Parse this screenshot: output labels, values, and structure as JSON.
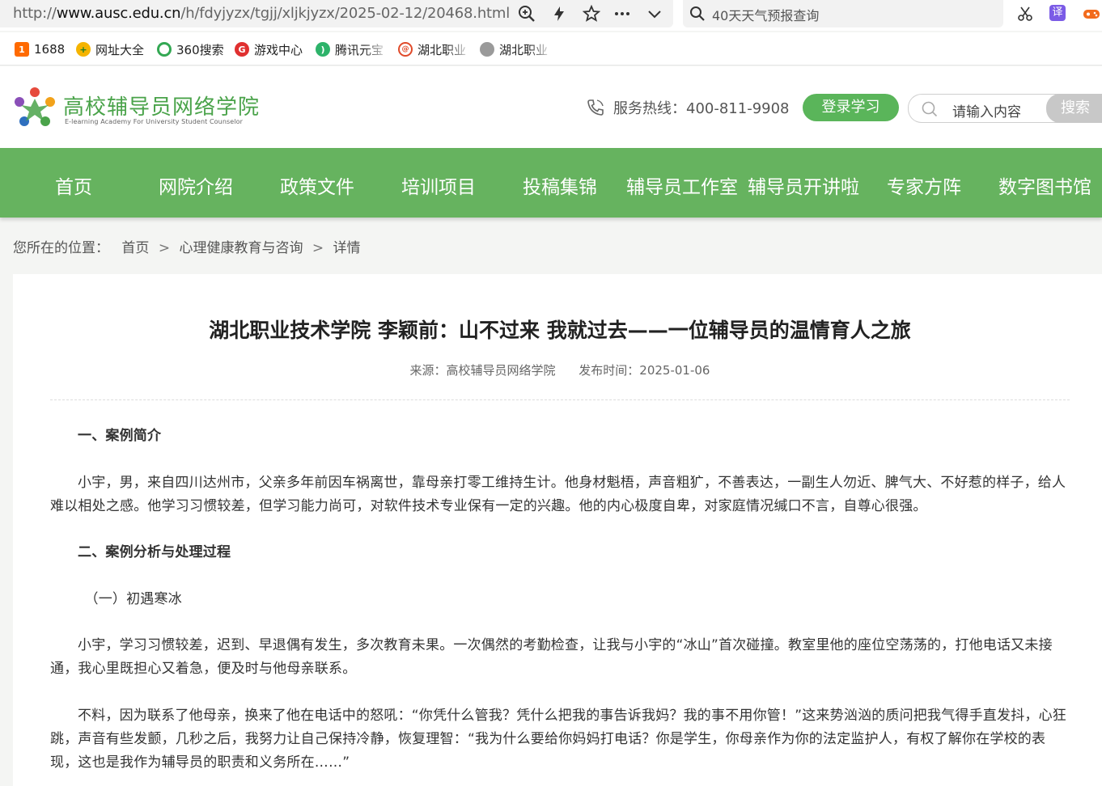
{
  "browser": {
    "url_prefix": "http://",
    "url_host": "www.ausc.edu.cn",
    "url_path": "/h/fdyjyzx/tgjj/xljkjyzx/2025-02-12/20468.html",
    "search_query": "40天天气预报查询",
    "bookmarks": [
      {
        "label": "1688",
        "icon": "1688-icon",
        "color": "#ff6a00"
      },
      {
        "label": "网址大全",
        "icon": "plus-icon",
        "color": "#f5b400"
      },
      {
        "label": "360搜索",
        "icon": "360-icon",
        "color": "#33a853"
      },
      {
        "label": "游戏中心",
        "icon": "game-icon",
        "color": "#e03030"
      },
      {
        "label": "腾讯元宝",
        "icon": "yuanbao-icon",
        "color": "#2db36a"
      },
      {
        "label": "湖北职业",
        "icon": "badge-icon",
        "color": "#e04a2a"
      },
      {
        "label": "湖北职业",
        "icon": "globe-icon",
        "color": "#9a9a9a"
      }
    ]
  },
  "site": {
    "title": "高校辅导员网络学院",
    "subtitle": "E-learning Academy For University Student Counselor",
    "hotline_label": "服务热线：400-811-9908",
    "login_label": "登录学习",
    "search_placeholder": "请输入内容",
    "search_button": "搜索",
    "accent_color": "#66b35f"
  },
  "nav": [
    "首页",
    "网院介绍",
    "政策文件",
    "培训项目",
    "投稿集锦",
    "辅导员工作室",
    "辅导员开讲啦",
    "专家方阵",
    "数字图书馆"
  ],
  "breadcrumb": {
    "prefix": "您所在的位置：",
    "items": [
      "首页",
      "心理健康教育与咨询",
      "详情"
    ],
    "sep": ">"
  },
  "article": {
    "title": "湖北职业技术学院 李颖前：山不过来 我就过去——一位辅导员的温情育人之旅",
    "source": "来源：高校辅导员网络学院",
    "date": "发布时间：2025-01-06",
    "paragraphs": [
      "一、案例简介",
      "小宇，男，来自四川达州市，父亲多年前因车祸离世，靠母亲打零工维持生计。他身材魁梧，声音粗犷，不善表达，一副生人勿近、脾气大、不好惹的样子，给人难以相处之感。他学习习惯较差，但学习能力尚可，对软件技术专业保有一定的兴趣。他的内心极度自卑，对家庭情况缄口不言，自尊心很强。",
      "二、案例分析与处理过程",
      "（一）初遇寒冰",
      "小宇，学习习惯较差，迟到、早退偶有发生，多次教育未果。一次偶然的考勤检查，让我与小宇的“冰山”首次碰撞。教室里他的座位空荡荡的，打他电话又未接通，我心里既担心又着急，便及时与他母亲联系。",
      "不料，因为联系了他母亲，换来了他在电话中的怒吼：“你凭什么管我？凭什么把我的事告诉我妈？我的事不用你管！”这来势汹汹的质问把我气得手直发抖，心狂跳，声音有些发颤，几秒之后，我努力让自己保持冷静，恢复理智：“我为什么要给你妈妈打电话？你是学生，你母亲作为你的法定监护人，有权了解你在学校的表现，这也是我作为辅导员的职责和义务所在……”"
    ]
  }
}
